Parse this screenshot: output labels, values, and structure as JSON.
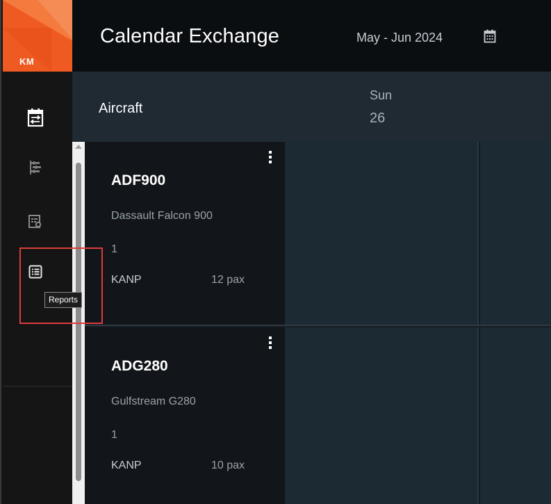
{
  "logo": {
    "initials": "KM"
  },
  "header": {
    "title": "Calendar Exchange",
    "date_range": "May - Jun 2024",
    "calendar_icon": "calendar-icon"
  },
  "sidebar": {
    "items": [
      {
        "id": "calendar-exchange",
        "icon": "calendar-exchange-icon",
        "active": true
      },
      {
        "id": "hierarchy",
        "icon": "tree-list-icon",
        "active": false
      },
      {
        "id": "search-records",
        "icon": "list-search-icon",
        "active": false
      },
      {
        "id": "reports",
        "icon": "report-list-icon",
        "active": false
      }
    ],
    "tooltip": "Reports"
  },
  "grid": {
    "row_header_label": "Aircraft",
    "days": [
      {
        "name": "Sun",
        "number": "26"
      }
    ]
  },
  "aircraft": [
    {
      "tail": "ADF900",
      "model": "Dassault Falcon 900",
      "count": "1",
      "base": "KANP",
      "pax": "12 pax"
    },
    {
      "tail": "ADG280",
      "model": "Gulfstream G280",
      "count": "1",
      "base": "KANP",
      "pax": "10 pax"
    }
  ],
  "colors": {
    "accent": "#ee5a22",
    "highlight": "#e03c3c",
    "header_bg": "#0b0e11",
    "cell_bg": "#1c2a34"
  }
}
